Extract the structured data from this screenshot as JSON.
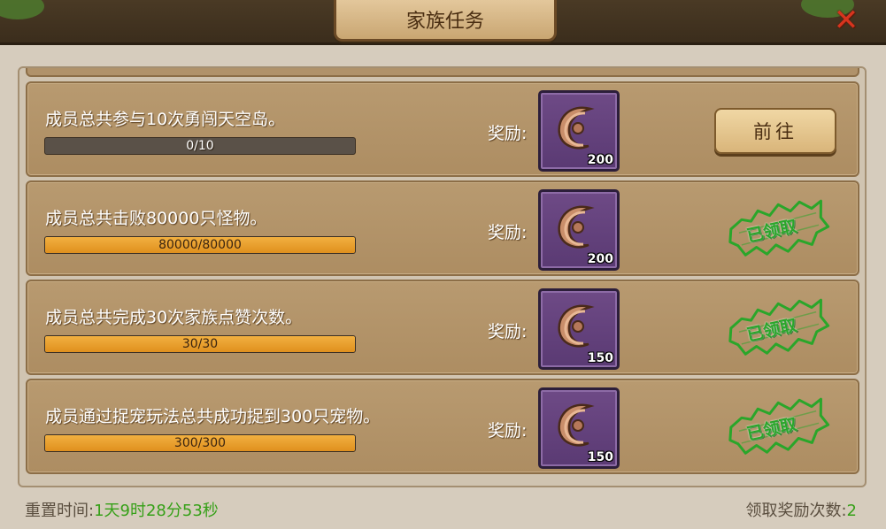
{
  "header": {
    "title": "家族任务"
  },
  "reward_label": "奖励:",
  "tasks": [
    {
      "description": "成员总共参与10次勇闯天空岛。",
      "progress_text": "0/10",
      "progress": 0.0,
      "reward_count": "200",
      "reward_icon": "crescent-stone-icon",
      "status": "go",
      "action_label": "前往"
    },
    {
      "description": "成员总共击败80000只怪物。",
      "progress_text": "80000/80000",
      "progress": 1.0,
      "reward_count": "200",
      "reward_icon": "crescent-stone-icon",
      "status": "claimed",
      "stamp_label": "已领取"
    },
    {
      "description": "成员总共完成30次家族点赞次数。",
      "progress_text": "30/30",
      "progress": 1.0,
      "reward_count": "150",
      "reward_icon": "crescent-stone-icon",
      "status": "claimed",
      "stamp_label": "已领取"
    },
    {
      "description": "成员通过捉宠玩法总共成功捉到300只宠物。",
      "progress_text": "300/300",
      "progress": 1.0,
      "reward_count": "150",
      "reward_icon": "crescent-stone-icon",
      "status": "claimed",
      "stamp_label": "已领取"
    }
  ],
  "footer": {
    "reset_label": "重置时间:",
    "reset_value": "1天9时28分53秒",
    "claims_label": "领取奖励次数:",
    "claims_value": "2"
  },
  "colors": {
    "accent_green": "#36a018",
    "progress_orange": "#eea030",
    "item_bg": "#5e3d78"
  }
}
